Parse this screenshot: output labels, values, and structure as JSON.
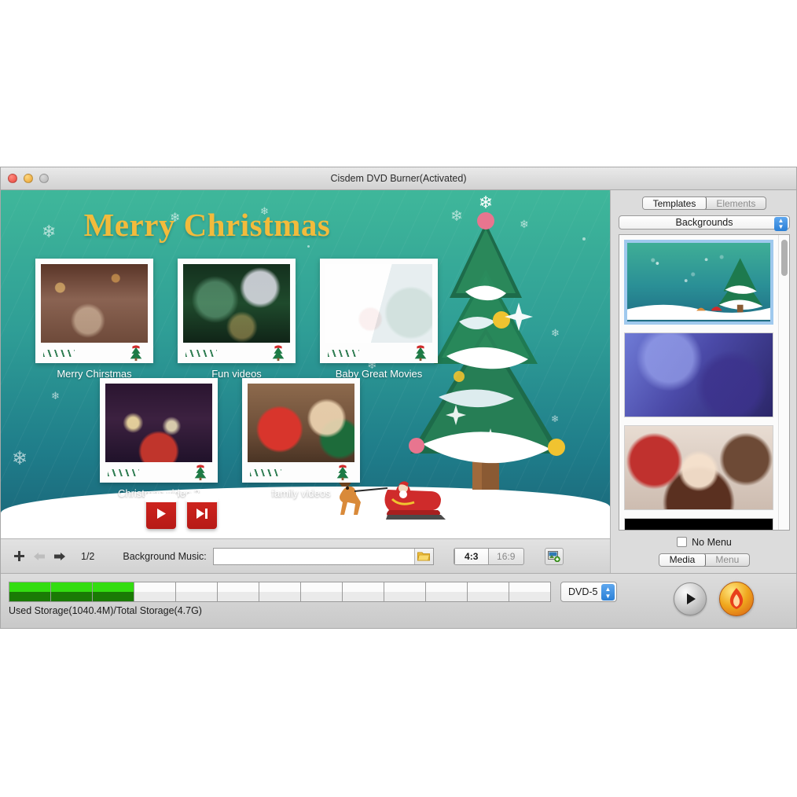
{
  "window": {
    "title": "Cisdem DVD Burner(Activated)",
    "traffic_lights": [
      "close-button",
      "minimize-button",
      "zoom-button"
    ]
  },
  "menu_preview": {
    "title": "Merry Christmas",
    "thumbnails": [
      {
        "caption": "Merry Chirstmas",
        "art": "ph-party"
      },
      {
        "caption": "Fun videos",
        "art": "ph-kid"
      },
      {
        "caption": "Baby Great Movies",
        "art": "ph-baby"
      },
      {
        "caption": "Christmas video 2",
        "art": "ph-sparkler"
      },
      {
        "caption": "family videos",
        "art": "ph-gift"
      }
    ],
    "nav_buttons": [
      "play-arrow-button",
      "next-arrow-button"
    ]
  },
  "toolbar": {
    "add_icon": "plus-icon",
    "prev_icon": "arrow-left-icon",
    "next_icon": "arrow-right-icon",
    "page_indicator": "1/2",
    "bgm_label": "Background Music:",
    "bgm_value": "",
    "bgm_placeholder": "",
    "browse_icon": "folder-icon",
    "ratios": [
      {
        "label": "4:3",
        "selected": true
      },
      {
        "label": "16:9",
        "selected": false
      }
    ],
    "add_image_icon": "add-image-icon"
  },
  "sidebar": {
    "top_tabs": [
      {
        "label": "Templates",
        "selected": true
      },
      {
        "label": "Elements",
        "selected": false
      }
    ],
    "category": "Backgrounds",
    "backgrounds": [
      {
        "name": "christmas-tree-snow-background",
        "art": "bg-xmas",
        "selected": true
      },
      {
        "name": "purple-bokeh-background",
        "art": "bg-purple",
        "selected": false
      },
      {
        "name": "birthday-candles-background",
        "art": "bg-birthday",
        "selected": false
      },
      {
        "name": "black-background",
        "art": "bg-black",
        "selected": false
      }
    ],
    "no_menu_label": "No Menu",
    "no_menu_checked": false,
    "bottom_tabs": [
      {
        "label": "Media",
        "selected": true
      },
      {
        "label": "Menu",
        "selected": false
      }
    ]
  },
  "statusbar": {
    "storage_segments_total": 13,
    "storage_segments_filled": 3,
    "storage_text": "Used Storage(1040.4M)/Total Storage(4.7G)",
    "disc_type": "DVD-5",
    "play_label": "play-icon",
    "burn_label": "burn-icon"
  },
  "colors": {
    "accent_blue": "#2a7fd6",
    "title_gold": "#f2bb3c",
    "storage_green": "#33dd11",
    "storage_green_dark": "#1a7a05",
    "bg_teal_top": "#3fb79a",
    "bg_teal_bottom": "#1a6478"
  }
}
